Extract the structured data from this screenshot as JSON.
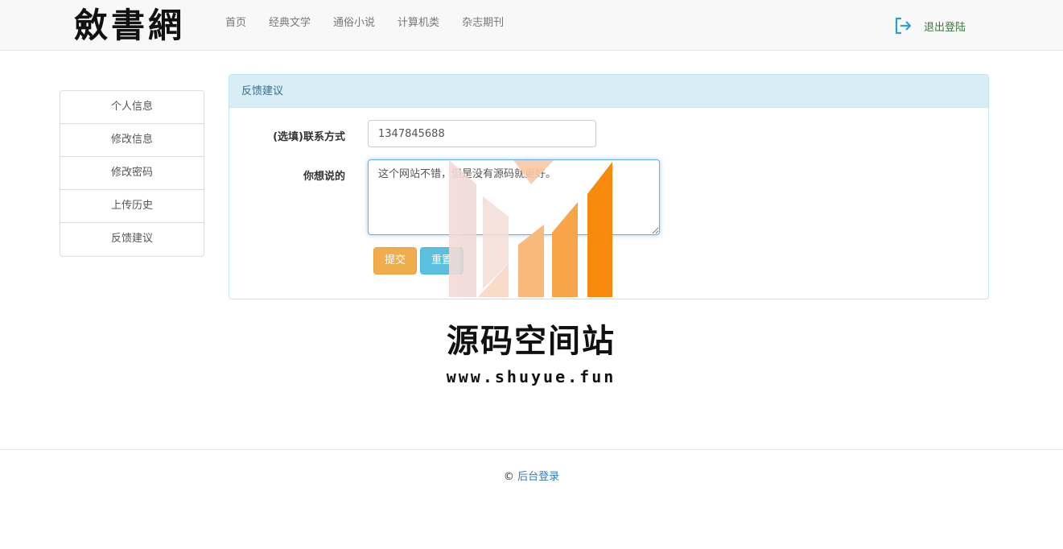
{
  "header": {
    "logo": "斂書網",
    "nav": [
      "首页",
      "经典文学",
      "通俗小说",
      "计算机类",
      "杂志期刊"
    ],
    "logout_label": "退出登陆",
    "logout_icon": "logout-icon",
    "logout_icon_color": "#2a9fd6"
  },
  "sidebar": {
    "items": [
      "个人信息",
      "修改信息",
      "修改密码",
      "上传历史",
      "反馈建议"
    ]
  },
  "panel": {
    "title": "反馈建议",
    "contact_label": "(选填)联系方式",
    "contact_value": "1347845688",
    "say_label": "你想说的",
    "say_value": "这个网站不错，但是没有源码就更好。",
    "submit_label": "提交",
    "reset_label": "重置"
  },
  "watermark": {
    "title": "源码空间站",
    "url": "www.shuyue.fun"
  },
  "footer": {
    "copyright_symbol": "©",
    "link_label": "后台登录"
  },
  "colors": {
    "panel_heading_bg": "#d9edf7",
    "submit_button": "#f0ad4e",
    "reset_button": "#5bc0de",
    "watermark_orange": "#f7890c"
  }
}
